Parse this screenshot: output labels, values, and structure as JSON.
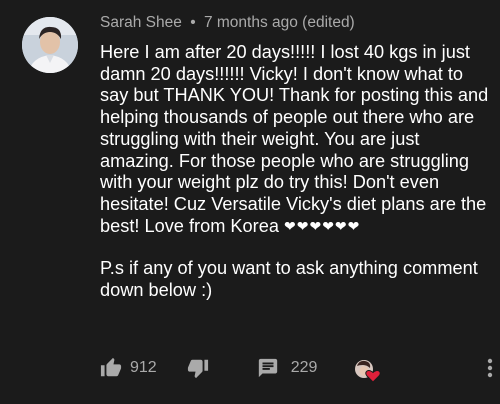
{
  "comment": {
    "author": "Sarah Shee",
    "separator": "•",
    "time": "7 months ago (edited)",
    "text_main": "Here I am after 20 days!!!!! I lost 40 kgs in just damn 20 days!!!!!! Vicky! I don't know what to say but THANK YOU! Thank for posting this and helping thousands of people out there who are struggling with their weight. You are just amazing. For those people who are struggling with your weight plz do try this! Don't even hesitate! Cuz Versatile Vicky's diet plans are the best! Love from Korea",
    "hearts": "❤❤❤❤❤❤",
    "text_ps": "P.s if any of you want to ask anything comment down below :)"
  },
  "actions": {
    "like_count": "912",
    "reply_count": "229"
  },
  "icons": {
    "like": "thumbs-up-icon",
    "dislike": "thumbs-down-icon",
    "reply": "comment-icon",
    "creator_heart": "creator-heart-icon",
    "more": "more-vertical-icon"
  },
  "colors": {
    "background": "#1b1b1b",
    "text": "#ffffff",
    "meta": "#aaaaaa",
    "heart": "#e0203a"
  }
}
